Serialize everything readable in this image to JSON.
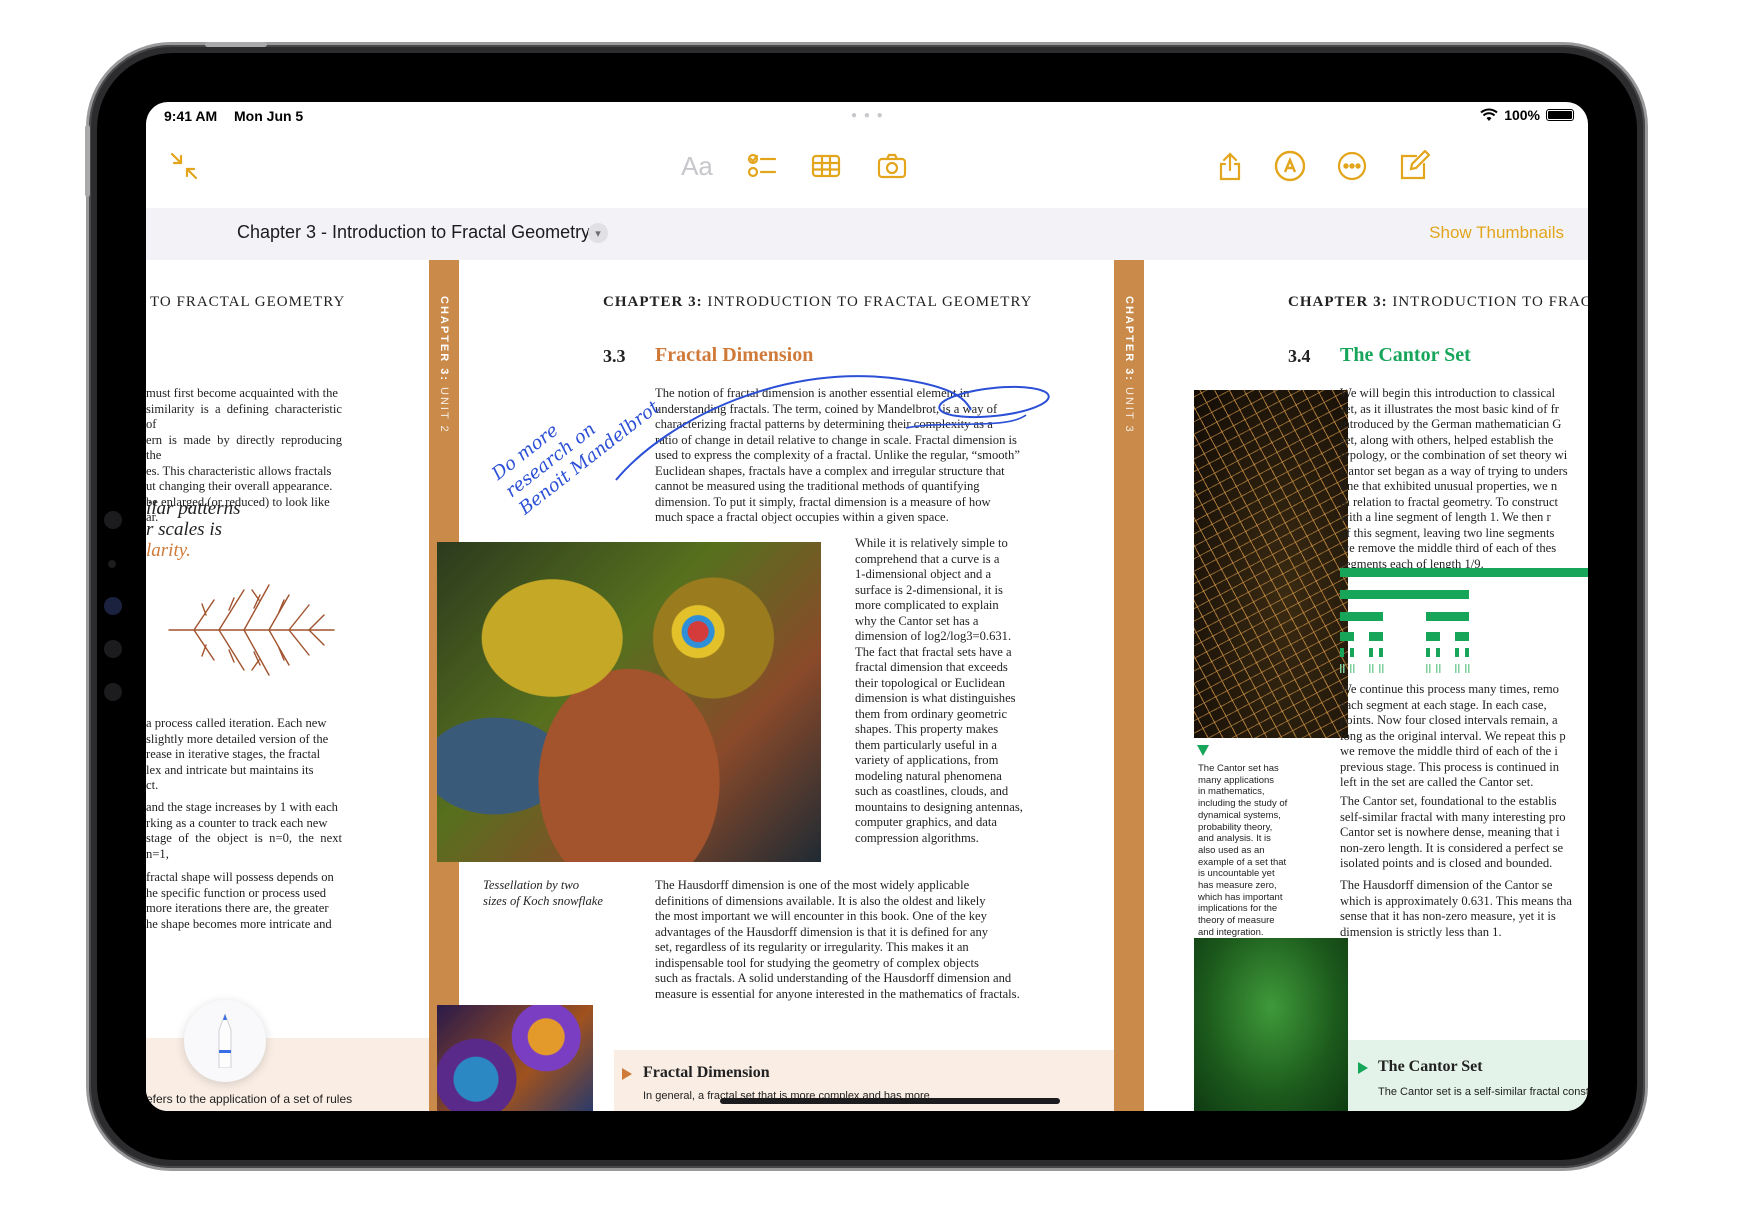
{
  "status_bar": {
    "time": "9:41 AM",
    "date": "Mon Jun 5",
    "battery": "100%",
    "battery_level": 1.0
  },
  "toolbar": {
    "left": [
      {
        "icon": "collapse-arrows-icon"
      }
    ],
    "center": [
      {
        "icon": "text-format-icon",
        "label": "Aa"
      },
      {
        "icon": "checklist-icon"
      },
      {
        "icon": "table-icon"
      },
      {
        "icon": "camera-icon"
      }
    ],
    "right": [
      {
        "icon": "share-icon"
      },
      {
        "icon": "markup-pen-icon"
      },
      {
        "icon": "more-ellipsis-icon"
      },
      {
        "icon": "compose-icon"
      }
    ],
    "accent": "#e3a51b"
  },
  "document": {
    "title": "Chapter 3 - Introduction to Fractal Geometry",
    "show_thumbnails": "Show Thumbnails"
  },
  "left_page": {
    "header": "TO FRACTAL GEOMETRY",
    "spine": {
      "chapter": "CHAPTER 3:",
      "unit": "UNIT 2"
    },
    "para1_lines": [
      "must first become acquainted with the",
      "similarity is a defining characteristic of",
      "ern is made by directly reproducing the",
      "es. This characteristic allows fractals",
      "ut changing their overall appearance.",
      "be enlarged (or reduced) to look like",
      "ar."
    ],
    "pull_quote": [
      "ilar patterns",
      "r scales is",
      "larity."
    ],
    "para2_lines": [
      "a process called iteration. Each new",
      "slightly more detailed version of the",
      "rease in iterative stages, the fractal",
      "lex and intricate but maintains its",
      "ct."
    ],
    "para3_lines": [
      "and the stage increases by 1 with each",
      "rking as a counter to track each new",
      "stage of the object is n=0, the next n=1,"
    ],
    "para4_lines": [
      "fractal shape will possess depends on",
      "he specific function or process used",
      "more iterations there are, the greater",
      "he shape becomes more intricate and"
    ],
    "footer_line": "efers to the application of a set of rules"
  },
  "center_page": {
    "header_bold": "CHAPTER 3:",
    "header_rest": " INTRODUCTION TO FRACTAL GEOMETRY",
    "spine": {
      "chapter": "CHAPTER 3:",
      "unit": "UNIT 3"
    },
    "section_number": "3.3",
    "section_title": "Fractal Dimension",
    "section_color": "#d07a3a",
    "intro_lines": [
      "The notion of fractal dimension is another essential element in",
      "understanding fractals. The term, coined by Mandelbrot, is a way of",
      "characterizing fractal patterns by determining their complexity as a",
      "ratio of change in detail relative to change in scale. Fractal dimension is",
      "used to express the complexity of a fractal. Unlike the regular, “smooth”",
      "Euclidean shapes, fractals have a complex and irregular structure that",
      "cannot be measured using the traditional methods of quantifying",
      "dimension. To put it simply, fractal dimension is a measure of how",
      "much space a fractal object occupies within a given space."
    ],
    "handwritten_note": [
      "Do more",
      "research on",
      "Benoit Mandelbrot"
    ],
    "side_col_lines": [
      "While it is relatively simple to",
      "comprehend that a curve is a",
      "1-dimensional object and a",
      "surface is 2-dimensional, it is",
      "more complicated to explain",
      "why the Cantor set has a",
      "dimension of log2/log3=0.631.",
      "The fact that fractal sets have a",
      "fractal dimension that exceeds",
      "their topological or Euclidean",
      "dimension is what distinguishes",
      "them from ordinary geometric",
      "shapes. This property makes",
      "them particularly useful in a",
      "variety of applications, from",
      "modeling natural phenomena",
      "such as coastlines, clouds, and",
      "mountains to designing antennas,",
      "computer graphics, and data",
      "compression algorithms."
    ],
    "image_caption": [
      "Tessellation by two",
      "sizes of Koch snowflake"
    ],
    "hausdorff_lines": [
      "The Hausdorff dimension is one of the most widely applicable",
      "definitions of dimensions available. It is also the oldest and likely",
      "the most important we will encounter in this book. One of the key",
      "advantages of the Hausdorff dimension is that it is defined for any",
      "set, regardless of its regularity or irregularity. This makes it an",
      "indispensable tool for studying the geometry of complex objects",
      "such as fractals. A solid understanding of the Hausdorff dimension and",
      "measure is essential for anyone interested in the mathematics of fractals."
    ],
    "callout_title": "Fractal Dimension",
    "callout_text": "In general, a fractal set that is more complex and has more"
  },
  "right_page": {
    "header_bold": "CHAPTER 3:",
    "header_rest": " INTRODUCTION TO FRAC",
    "section_number": "3.4",
    "section_title": "The Cantor Set",
    "section_color": "#17a55a",
    "intro_lines": [
      "We will begin this introduction to classical",
      "set, as it illustrates the most basic kind of fr",
      "introduced by the German mathematician G",
      "set, along with others, helped establish the",
      "typology, or the combination of set theory wi",
      "Cantor set began as a way of trying to unders",
      "line that exhibited unusual properties, we n",
      "in relation to fractal geometry. To construct",
      "with a line segment of length 1. We then r",
      "of this segment, leaving two line segments",
      "we remove the middle third of each of thes",
      "segments each of length 1/9."
    ],
    "leaf_caption_lines": [
      "The Cantor set has",
      "many applications",
      "in mathematics,",
      "including the study of",
      "dynamical systems,",
      "probability theory,",
      "and analysis. It is",
      "also used as an",
      "example of a set that",
      "is uncountable yet",
      "has measure zero,",
      "which has important",
      "implications for the",
      "theory of measure",
      "and integration."
    ],
    "para2_lines": [
      "We continue this process many times, remo",
      "each segment at each stage. In each case,",
      "points. Now four closed intervals remain, a",
      "long as the original interval. We repeat this p",
      "we remove the middle third of each of the i",
      "previous stage. This process is continued in",
      "left in the set are called the Cantor set."
    ],
    "para3_lines": [
      "The Cantor set, foundational to the establis",
      "self-similar fractal with many interesting pro",
      "Cantor set is nowhere dense, meaning that i",
      "non-zero length. It is considered a perfect se",
      "isolated points and is closed and bounded."
    ],
    "para4_lines": [
      "The Hausdorff dimension of the Cantor se",
      "which is approximately 0.631. This means tha",
      "sense that it has non-zero measure, yet it is",
      "dimension is strictly less than 1."
    ],
    "callout_title": "The Cantor Set",
    "callout_text": "The Cantor set is a self-similar fractal constru"
  }
}
